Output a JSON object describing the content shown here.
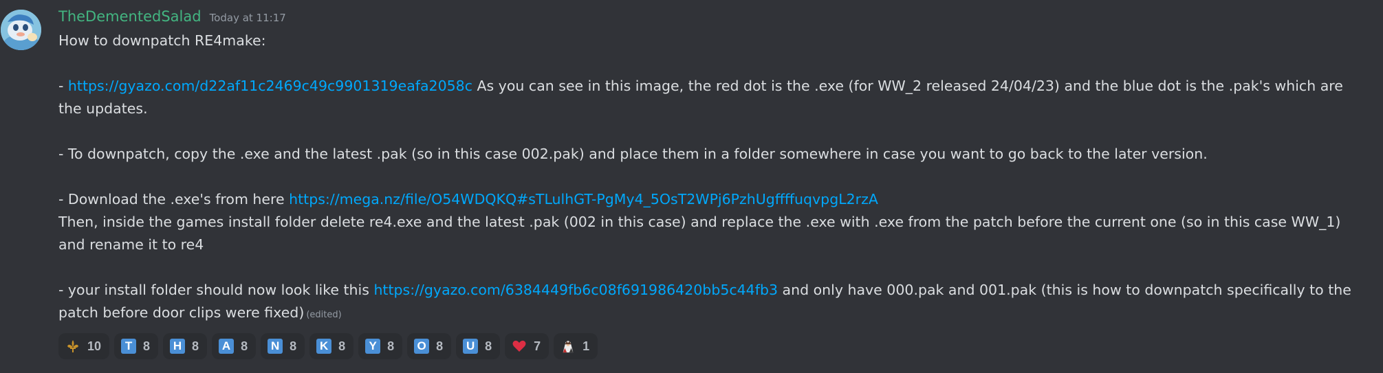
{
  "message": {
    "author": "TheDementedSalad",
    "timestamp": "Today at 11:17",
    "lines": {
      "l1": "How to downpatch RE4make:",
      "l2_prefix": "- ",
      "l2_link": "https://gyazo.com/d22af11c2469c49c9901319eafa2058c",
      "l2_text": " As you can see in this image, the red dot is the .exe (for WW_2 released 24/04/23) and the blue dot is the .pak's which are the updates.",
      "l3": "- To downpatch, copy the .exe and the latest .pak (so in this case 002.pak) and place them in a folder somewhere in case you want to go back to the later version.",
      "l4_prefix": "- Download the .exe's from here ",
      "l4_link": "https://mega.nz/file/O54WDQKQ#sTLulhGT-PgMy4_5OsT2WPj6PzhUgffffuqvpgL2rzA",
      "l5": "Then, inside the games install folder delete re4.exe and the latest .pak (002 in this case) and replace the .exe with .exe from the patch before the current one (so in this case WW_1) and rename it to re4",
      "l6_prefix": "- your install folder should now look like this ",
      "l6_link": "https://gyazo.com/6384449fb6c08f691986420bb5c44fb3",
      "l6_text": " and only have 000.pak and 001.pak (this is how to downpatch specifically to the patch before door clips were fixed)",
      "edited": "(edited)"
    }
  },
  "reactions": [
    {
      "emoji": "fleur-de-lis",
      "count": "10"
    },
    {
      "letter": "T",
      "count": "8"
    },
    {
      "letter": "H",
      "count": "8"
    },
    {
      "letter": "A",
      "count": "8"
    },
    {
      "letter": "N",
      "count": "8"
    },
    {
      "letter": "K",
      "count": "8"
    },
    {
      "letter": "Y",
      "count": "8"
    },
    {
      "letter": "O",
      "count": "8"
    },
    {
      "letter": "U",
      "count": "8"
    },
    {
      "emoji": "red-heart",
      "count": "7"
    },
    {
      "emoji": "custom-character",
      "count": "1"
    }
  ],
  "colors": {
    "background": "#313338",
    "username": "#43b581",
    "link": "#00a8fc",
    "regional_indicator": "#4a8fd6",
    "heart": "#dd2e44"
  }
}
